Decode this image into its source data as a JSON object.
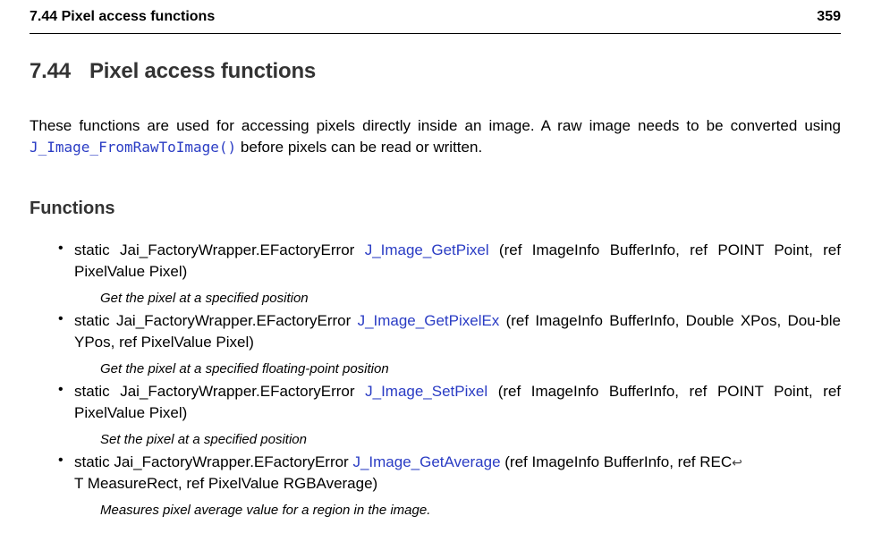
{
  "header": {
    "section_title": "7.44 Pixel access functions",
    "page_number": "359"
  },
  "section": {
    "number": "7.44",
    "title": "Pixel access functions"
  },
  "intro": {
    "text_before": "These functions are used for accessing pixels directly inside an image. A raw image needs to be converted using ",
    "link": "J_Image_FromRawToImage()",
    "text_after": " before pixels can be read or written."
  },
  "functions_heading": "Functions",
  "functions": [
    {
      "prefix": "static Jai_FactoryWrapper.EFactoryError ",
      "name": "J_Image_GetPixel",
      "params": " (ref ImageInfo BufferInfo, ref POINT Point, ref PixelValue Pixel)",
      "continuation": "",
      "description": "Get the pixel at a specified position"
    },
    {
      "prefix": "static Jai_FactoryWrapper.EFactoryError ",
      "name": "J_Image_GetPixelEx",
      "params": " (ref ImageInfo BufferInfo, Double XPos, Dou-ble YPos, ref PixelValue Pixel)",
      "continuation": "",
      "description": "Get the pixel at a specified floating-point position"
    },
    {
      "prefix": "static Jai_FactoryWrapper.EFactoryError ",
      "name": "J_Image_SetPixel",
      "params": " (ref ImageInfo BufferInfo, ref POINT Point, ref PixelValue Pixel)",
      "continuation": "",
      "description": "Set the pixel at a specified position"
    },
    {
      "prefix": "static Jai_FactoryWrapper.EFactoryError ",
      "name": "J_Image_GetAverage",
      "params": " (ref ImageInfo BufferInfo, ref REC",
      "continuation": "T MeasureRect, ref PixelValue RGBAverage)",
      "description": "Measures pixel average value for a region in the image."
    }
  ],
  "icons": {
    "bullet": "bullet-icon",
    "line_continuation": "return-arrow-icon"
  },
  "colors": {
    "link": "#2a3cc4",
    "heading": "#333333"
  }
}
